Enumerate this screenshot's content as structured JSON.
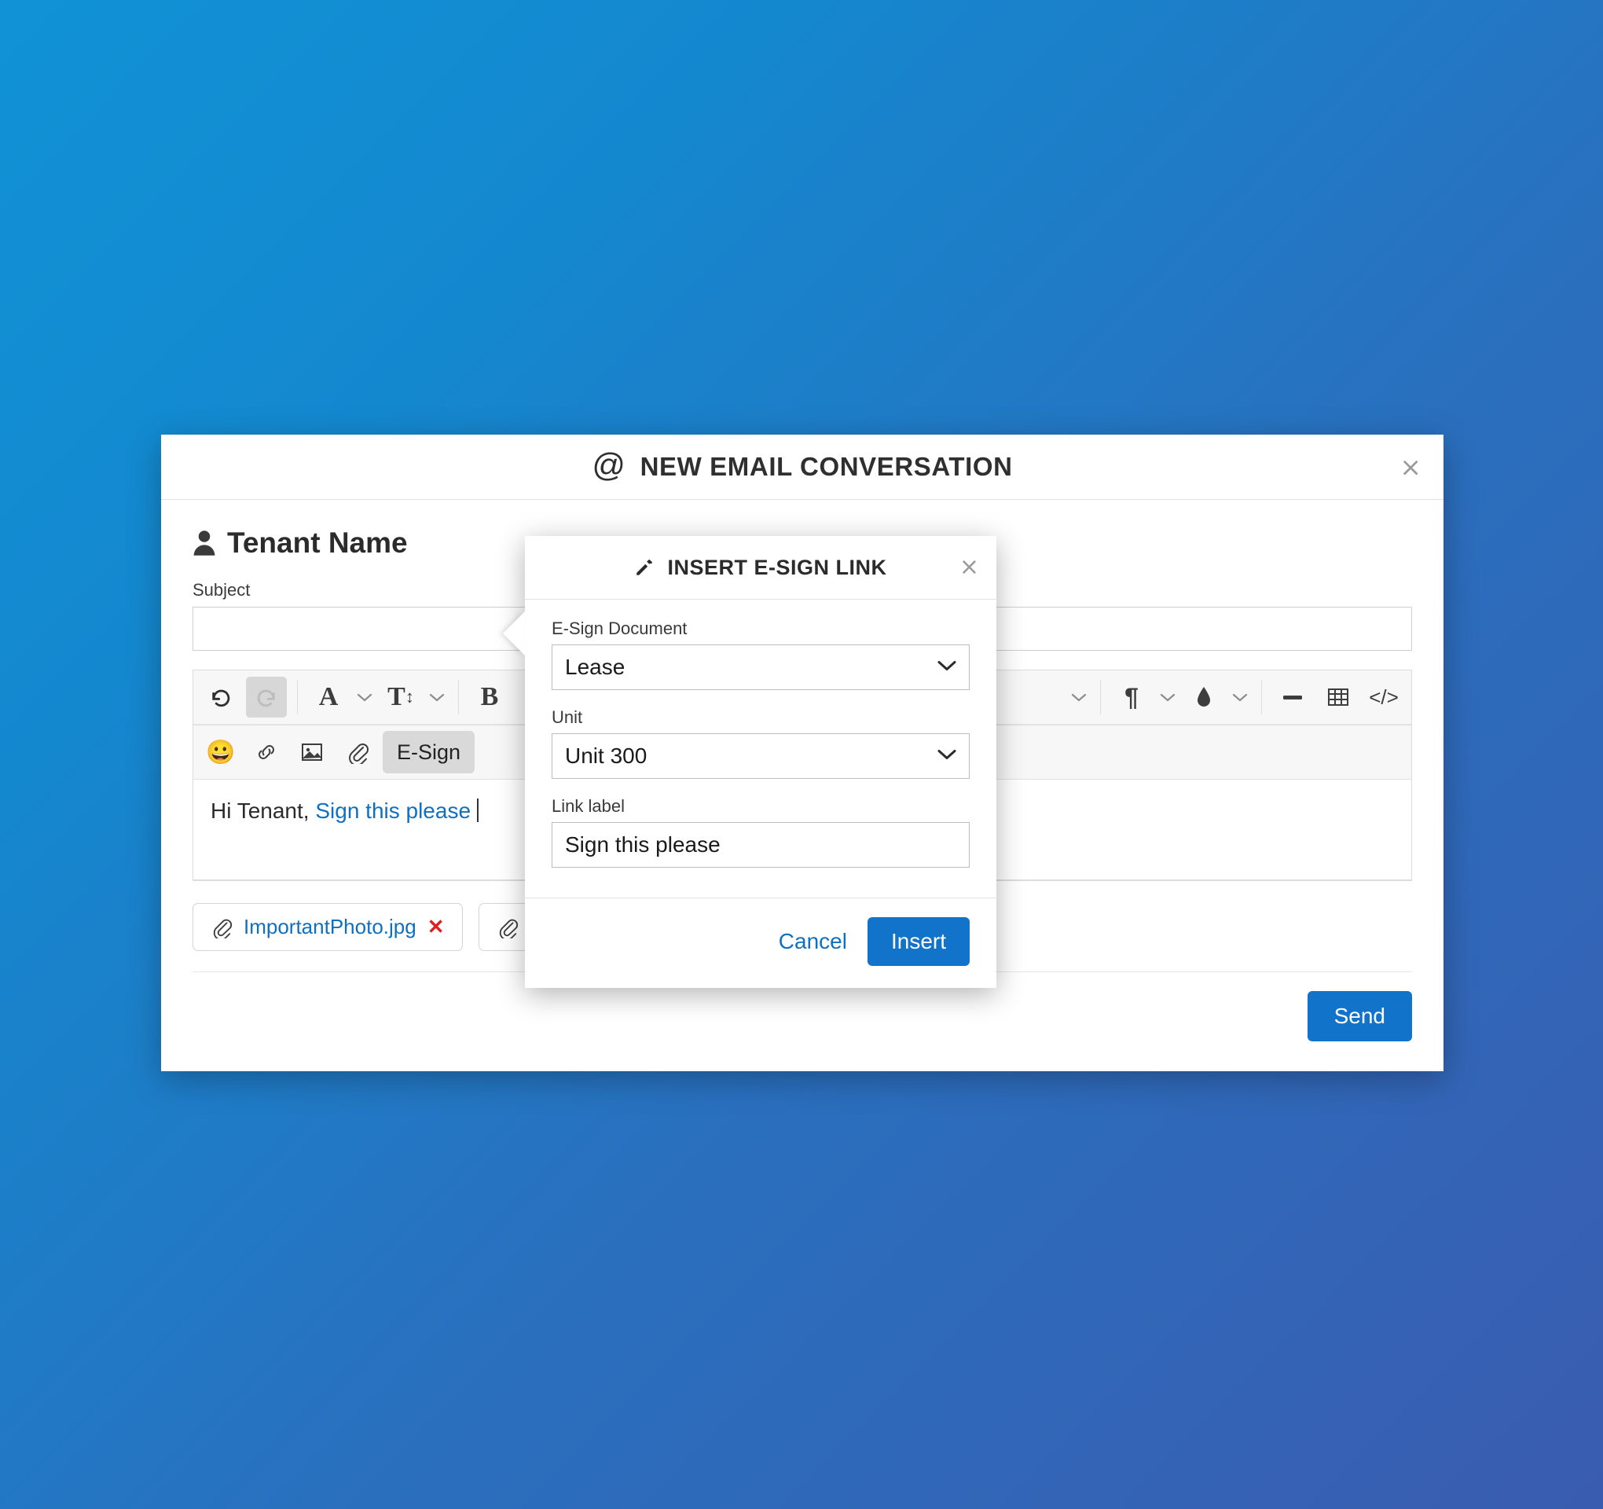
{
  "window": {
    "title": "NEW EMAIL CONVERSATION",
    "at_icon": "@",
    "close_icon": "×",
    "recipient": "Tenant Name",
    "person_icon": "person-icon"
  },
  "subject": {
    "label": "Subject",
    "value": "",
    "placeholder": ""
  },
  "toolbar": {
    "row1": [
      {
        "name": "undo-icon",
        "glyph": "↺",
        "kind": "icon",
        "state": "enabled"
      },
      {
        "name": "redo-icon",
        "glyph": "↻",
        "kind": "icon",
        "state": "disabled"
      },
      {
        "name": "separator",
        "kind": "sep"
      },
      {
        "name": "font-family-icon",
        "glyph": "A",
        "kind": "serif"
      },
      {
        "name": "font-family-caret-icon",
        "glyph": "⌄",
        "kind": "caret"
      },
      {
        "name": "font-size-icon",
        "glyph": "T↕",
        "kind": "serif"
      },
      {
        "name": "font-size-caret-icon",
        "glyph": "⌄",
        "kind": "caret"
      },
      {
        "name": "separator",
        "kind": "sep"
      },
      {
        "name": "bold-icon",
        "glyph": "B",
        "kind": "serif"
      },
      {
        "name": "spacer",
        "kind": "spacer"
      },
      {
        "name": "align-caret-icon",
        "glyph": "⌄",
        "kind": "caret"
      },
      {
        "name": "separator",
        "kind": "sep"
      },
      {
        "name": "paragraph-format-icon",
        "glyph": "¶",
        "kind": "icon"
      },
      {
        "name": "paragraph-format-caret-icon",
        "glyph": "⌄",
        "kind": "caret"
      },
      {
        "name": "text-color-icon",
        "glyph": "💧",
        "kind": "drop"
      },
      {
        "name": "text-color-caret-icon",
        "glyph": "⌄",
        "kind": "caret"
      },
      {
        "name": "separator",
        "kind": "sep"
      },
      {
        "name": "horizontal-rule-icon",
        "glyph": "—",
        "kind": "icon"
      },
      {
        "name": "insert-table-icon",
        "glyph": "table",
        "kind": "table"
      },
      {
        "name": "code-view-icon",
        "glyph": "</>",
        "kind": "icon"
      }
    ],
    "row2": [
      {
        "name": "emoji-icon",
        "glyph": "😀",
        "kind": "emoji"
      },
      {
        "name": "insert-link-icon",
        "glyph": "link",
        "kind": "link"
      },
      {
        "name": "insert-image-icon",
        "glyph": "image",
        "kind": "image"
      },
      {
        "name": "attach-file-icon",
        "glyph": "clip",
        "kind": "clip"
      },
      {
        "name": "esign-button",
        "glyph": "E-Sign",
        "kind": "label",
        "state": "active"
      }
    ]
  },
  "editor": {
    "body_prefix": "Hi Tenant, ",
    "body_link": "Sign this please"
  },
  "attachments": [
    {
      "name": "ImportantPhoto.jpg",
      "remove_icon": "✕",
      "clip_icon": "paperclip-icon"
    },
    {
      "name": "",
      "remove_icon": "",
      "clip_icon": "paperclip-icon"
    }
  ],
  "footer": {
    "send_label": "Send"
  },
  "esign_modal": {
    "title": "INSERT E-SIGN LINK",
    "pencil_icon": "pencil-icon",
    "close_icon": "×",
    "document": {
      "label": "E-Sign Document",
      "value": "Lease"
    },
    "unit": {
      "label": "Unit",
      "value": "Unit 300"
    },
    "link_label": {
      "label": "Link label",
      "value": "Sign this please",
      "placeholder": "Link label"
    },
    "cancel_label": "Cancel",
    "insert_label": "Insert"
  },
  "colors": {
    "accent": "#1273ca",
    "link": "#1070c0",
    "danger": "#e02020",
    "bg_start": "#1192d6",
    "bg_end": "#3a5cb0"
  }
}
